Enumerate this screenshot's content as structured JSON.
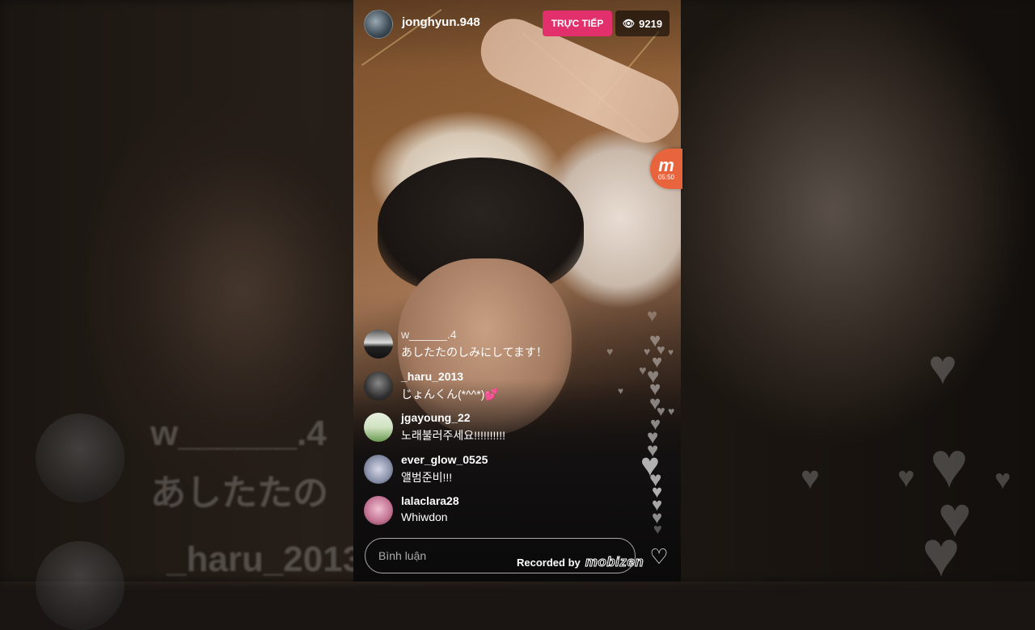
{
  "host": {
    "username": "jonghyun.948",
    "live_label": "TRỰC TIẾP",
    "viewer_count": "9219",
    "eye_icon": "eye-icon"
  },
  "recorder": {
    "logo": "m",
    "time": "05:50"
  },
  "comments": [
    {
      "user": "w______.4",
      "text": "あしたたのしみにしてます！"
    },
    {
      "user": "_haru_2013",
      "text": "じょんくん(*^^*)"
    },
    {
      "user": "jgayoung_22",
      "text": "노래불러주세요!!!!!!!!!!"
    },
    {
      "user": "ever_glow_0525",
      "text": "앨범준비!!!"
    },
    {
      "user": "lalaclara28",
      "text": "Whiwdon"
    }
  ],
  "inline_heart": "💕",
  "ghost": {
    "user1": "w______.4",
    "text1": "あしたたの",
    "user2": "_haru_2013"
  },
  "bottom": {
    "comment_placeholder": "Bình luận",
    "recorded_by": "Recorded by",
    "recorder_brand": "mobizen",
    "like_icon": "heart-icon"
  },
  "colors": {
    "live_badge": "#e1306c",
    "recorder_bubble": "#e8643c"
  }
}
